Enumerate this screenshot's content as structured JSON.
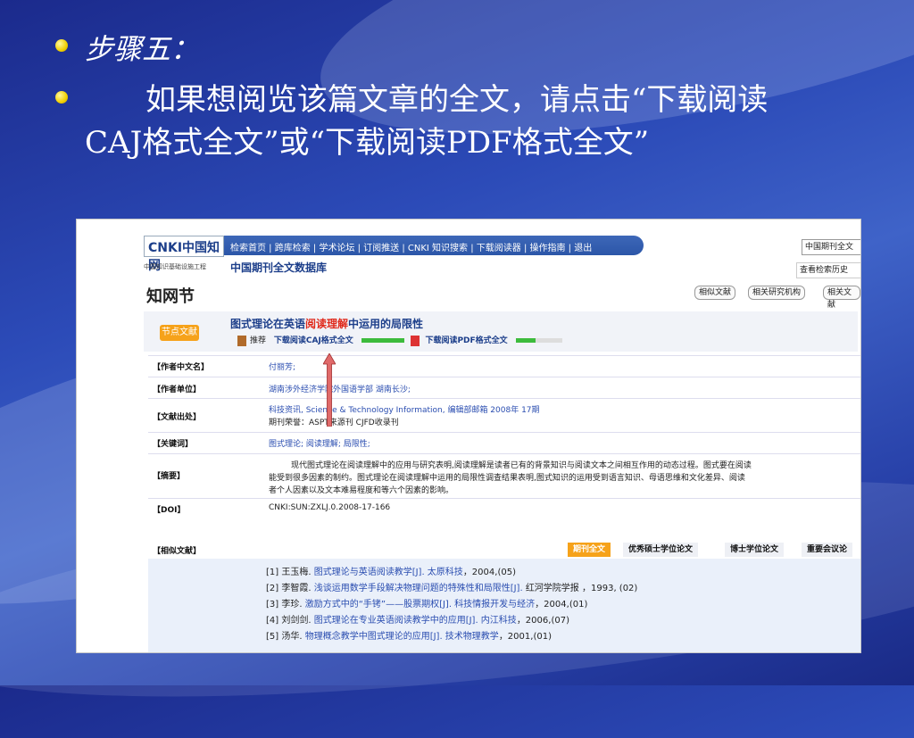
{
  "slide": {
    "step_title": "步骤五：",
    "paragraph": "　　如果想阅览该篇文章的全文，请点击“下载阅读CAJ格式全文”或“下载阅读PDF格式全文”"
  },
  "cnki": {
    "logo_text": "CNKI中国知网",
    "nav": "检索首页 | 跨库检索 | 学术论坛 | 订阅推送 | CNKI 知识搜索 | 下载阅读器 | 操作指南 | 退出",
    "subtitle": "中国知识基础设施工程",
    "db_name": "中国期刊全文数据库",
    "db_select": "中国期刊全文",
    "history_btn": "查看检索历史",
    "zhijie": "知网节",
    "related_doc_btn": "相似文献",
    "related_inst_btn": "相关研究机构",
    "related_more_btn": "相关文献",
    "badge": "节点文献",
    "title_pre": "图式理论在英语",
    "title_hl": "阅读理解",
    "title_post": "中运用的局限性",
    "recommend": "推荐",
    "dl_caj": "下载阅读CAJ格式全文",
    "dl_pdf": "下载阅读PDF格式全文",
    "rows": {
      "author_label": "【作者中文名】",
      "author_val": "付丽芳;",
      "unit_label": "【作者单位】",
      "unit_val": "湖南涉外经济学院外国语学部 湖南长沙;",
      "source_label": "【文献出处】",
      "source_val": "科技资讯, Science & Technology Information, 编辑部邮箱 2008年 17期",
      "source_val2": "期刊荣誉：ASPT来源刊 CJFD收录刊",
      "kw_label": "【关键词】",
      "kw_val": "图式理论; 阅读理解; 局限性;",
      "abs_label": "【摘要】",
      "abs_val1": "现代图式理论在阅读理解中的应用与研究表明,阅读理解是读者已有的背景知识与阅读文本之间相互作用的动态过程。图式要在阅读",
      "abs_val2": "能受到很多因素的制约。图式理论在阅读理解中运用的局限性调查结果表明,图式知识的运用受到语言知识、母语思维和文化差异、阅读",
      "abs_val3": "者个人因素以及文本难易程度和等六个因素的影响。",
      "doi_label": "【DOI】",
      "doi_val": "CNKI:SUN:ZXLJ.0.2008-17-166",
      "similar_label": "【相似文献】"
    },
    "tabs": [
      "期刊全文",
      "优秀硕士学位论文",
      "博士学位论文",
      "重要会议论"
    ],
    "list": [
      {
        "pre": "[1] 王玉梅. ",
        "link": "图式理论与英语阅读教学[J]. 太原科技",
        "post": "，2004,(05)"
      },
      {
        "pre": "[2] 李智霞. ",
        "link": "浅谈运用数学手段解决物理问题的特殊性和局限性[J]. ",
        "post": "红河学院学报 ，1993, (02)"
      },
      {
        "pre": "[3] 李珍. ",
        "link": "激励方式中的“手铐”——股票期权[J]. 科技情报开发与经济",
        "post": "，2004,(01)"
      },
      {
        "pre": "[4] 刘剑剑. ",
        "link": "图式理论在专业英语阅读教学中的应用[J]. 内江科技",
        "post": "，2006,(07)"
      },
      {
        "pre": "[5] 汤华. ",
        "link": "物理概念教学中图式理论的应用[J]. 技术物理教学",
        "post": "，2001,(01)"
      }
    ]
  }
}
